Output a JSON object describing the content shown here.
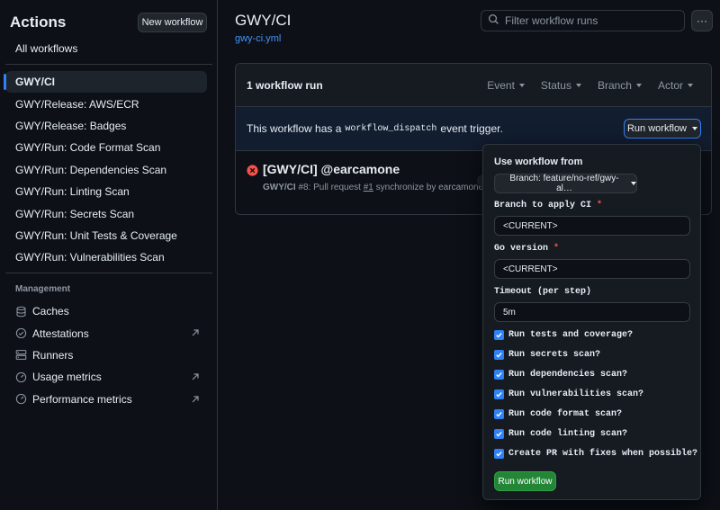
{
  "sidebar": {
    "title": "Actions",
    "new_workflow": "New workflow",
    "all_workflows": "All workflows",
    "workflows": [
      {
        "label": "GWY/CI",
        "active": true
      },
      {
        "label": "GWY/Release: AWS/ECR"
      },
      {
        "label": "GWY/Release: Badges"
      },
      {
        "label": "GWY/Run: Code Format Scan"
      },
      {
        "label": "GWY/Run: Dependencies Scan"
      },
      {
        "label": "GWY/Run: Linting Scan"
      },
      {
        "label": "GWY/Run: Secrets Scan"
      },
      {
        "label": "GWY/Run: Unit Tests & Coverage"
      },
      {
        "label": "GWY/Run: Vulnerabilities Scan"
      }
    ],
    "management_label": "Management",
    "management": [
      {
        "label": "Caches",
        "icon": "database-icon"
      },
      {
        "label": "Attestations",
        "icon": "check-circle-icon",
        "external": true
      },
      {
        "label": "Runners",
        "icon": "server-icon"
      },
      {
        "label": "Usage metrics",
        "icon": "meter-icon",
        "external": true
      },
      {
        "label": "Performance metrics",
        "icon": "meter-icon",
        "external": true
      }
    ]
  },
  "header": {
    "title": "GWY/CI",
    "file_link": "gwy-ci.yml",
    "filter_placeholder": "Filter workflow runs",
    "more_label": "···"
  },
  "runs": {
    "count_label": "1 workflow run",
    "filters": [
      "Event",
      "Status",
      "Branch",
      "Actor"
    ],
    "dispatch_prefix": "This workflow has a",
    "dispatch_code": "workflow_dispatch",
    "dispatch_suffix": "event trigger.",
    "run_workflow_button": "Run workflow",
    "items": [
      {
        "title": "[GWY/CI] @earcamone",
        "workflow": "GWY/CI",
        "number": "#8: Pull request",
        "pr": "#1",
        "tail": "synchronize by earcamone",
        "status": "failure"
      }
    ]
  },
  "popover": {
    "use_from_label": "Use workflow from",
    "branch_button": "Branch: feature/no-ref/gwy-al…",
    "inputs": [
      {
        "label": "Branch to apply CI",
        "required": true,
        "value": "<CURRENT>"
      },
      {
        "label": "Go version",
        "required": true,
        "value": "<CURRENT>"
      },
      {
        "label": "Timeout (per step)",
        "required": false,
        "value": "5m"
      }
    ],
    "required_mark": "*",
    "checkboxes": [
      {
        "label": "Run tests and coverage?",
        "checked": true
      },
      {
        "label": "Run secrets scan?",
        "checked": true
      },
      {
        "label": "Run dependencies scan?",
        "checked": true
      },
      {
        "label": "Run vulnerabilities scan?",
        "checked": true
      },
      {
        "label": "Run code format scan?",
        "checked": true
      },
      {
        "label": "Run code linting scan?",
        "checked": true
      },
      {
        "label": "Create PR with fixes when possible?",
        "checked": true
      }
    ],
    "submit": "Run workflow"
  },
  "colors": {
    "background": "#0d1117",
    "accent": "#2f81f7",
    "success_button": "#238636",
    "failure": "#f85149"
  }
}
